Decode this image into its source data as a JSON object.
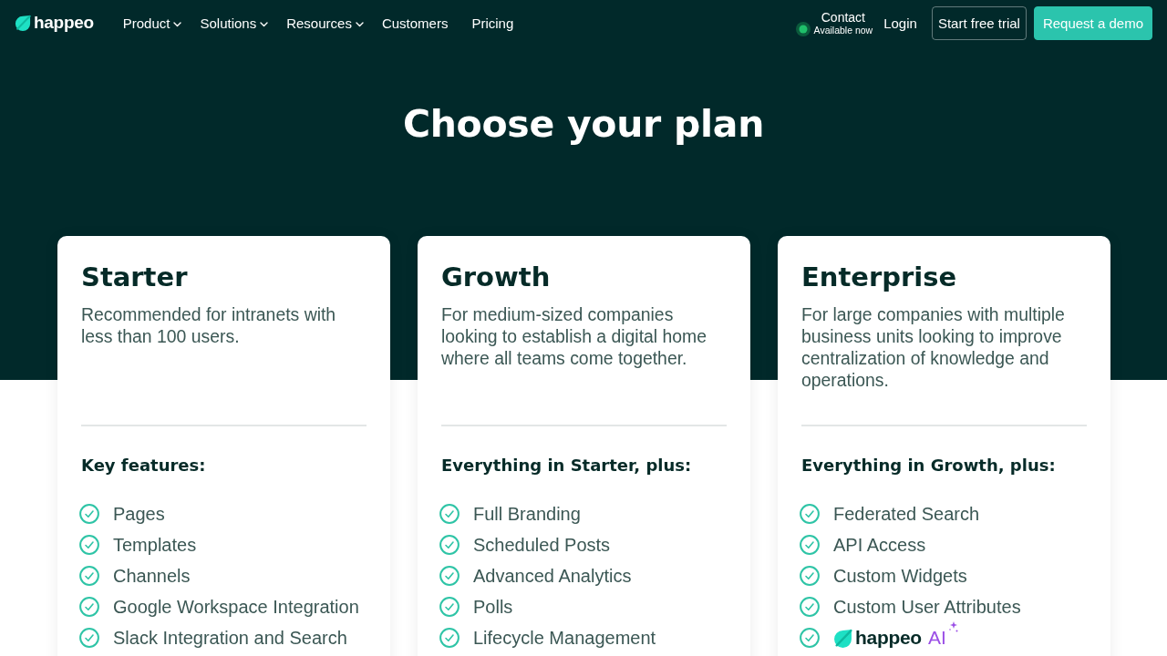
{
  "nav": {
    "logo": "happeo",
    "items": [
      {
        "label": "Product",
        "dropdown": true
      },
      {
        "label": "Solutions",
        "dropdown": true
      },
      {
        "label": "Resources",
        "dropdown": true
      },
      {
        "label": "Customers",
        "dropdown": false
      },
      {
        "label": "Pricing",
        "dropdown": false
      }
    ],
    "contact": {
      "label": "Contact",
      "status": "Available now",
      "online": true
    },
    "login": "Login",
    "buttons": [
      {
        "label": "Start free trial",
        "kind": "outline"
      },
      {
        "label": "Request a demo",
        "kind": "primary"
      }
    ]
  },
  "hero": {
    "title": "Choose your plan"
  },
  "plans": [
    {
      "name": "Starter",
      "description": "Recommended for intranets with less than 100 users.",
      "features_heading": "Key features:",
      "features": [
        {
          "kind": "text",
          "label": "Pages"
        },
        {
          "kind": "text",
          "label": "Templates"
        },
        {
          "kind": "text",
          "label": "Channels"
        },
        {
          "kind": "text",
          "label": "Google Workspace Integration"
        },
        {
          "kind": "text",
          "label": "Slack Integration and Search"
        }
      ]
    },
    {
      "name": "Growth",
      "description": "For medium-sized companies looking to establish a digital home where all teams come together.",
      "features_heading": "Everything in Starter, plus:",
      "features": [
        {
          "kind": "text",
          "label": "Full Branding"
        },
        {
          "kind": "text",
          "label": "Scheduled Posts"
        },
        {
          "kind": "text",
          "label": "Advanced Analytics"
        },
        {
          "kind": "text",
          "label": "Polls"
        },
        {
          "kind": "text",
          "label": "Lifecycle Management"
        }
      ]
    },
    {
      "name": "Enterprise",
      "description": "For large companies with multiple business units looking to improve centralization of knowledge and operations.",
      "features_heading": "Everything in Growth, plus:",
      "features": [
        {
          "kind": "text",
          "label": "Federated Search"
        },
        {
          "kind": "text",
          "label": "API Access"
        },
        {
          "kind": "text",
          "label": "Custom Widgets"
        },
        {
          "kind": "text",
          "label": "Custom User Attributes"
        },
        {
          "kind": "logo",
          "brand": "happeo",
          "label": "AI"
        }
      ]
    }
  ]
}
